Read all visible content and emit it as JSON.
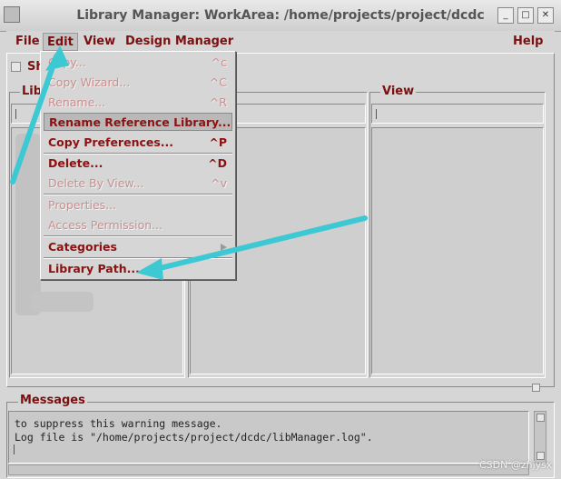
{
  "window": {
    "title": "Library Manager: WorkArea: /home/projects/project/dcdc"
  },
  "menubar": {
    "file": "File",
    "edit": "Edit",
    "view": "View",
    "design_manager": "Design Manager",
    "help": "Help"
  },
  "panes": {
    "show_checkbox_label": "Sh",
    "library_label": "Libr",
    "view_label": "View"
  },
  "edit_menu": {
    "items": [
      {
        "label": "Copy...",
        "shortcut": "^c",
        "enabled": false
      },
      {
        "label": "Copy Wizard...",
        "shortcut": "^C",
        "enabled": false
      },
      {
        "label": "Rename...",
        "shortcut": "^R",
        "enabled": false
      },
      {
        "label": "Rename Reference Library...",
        "shortcut": "",
        "enabled": true,
        "highlighted": true
      },
      {
        "label": "Copy Preferences...",
        "shortcut": "^P",
        "enabled": true
      },
      {
        "label": "Delete...",
        "shortcut": "^D",
        "enabled": true
      },
      {
        "label": "Delete By View...",
        "shortcut": "^v",
        "enabled": false
      },
      {
        "label": "Properties...",
        "shortcut": "",
        "enabled": false
      },
      {
        "label": "Access Permission...",
        "shortcut": "",
        "enabled": false
      },
      {
        "label": "Categories",
        "shortcut": "",
        "enabled": true,
        "submenu": true
      },
      {
        "label": "Library Path...",
        "shortcut": "",
        "enabled": true
      }
    ]
  },
  "messages": {
    "title": "Messages",
    "lines": [
      "to suppress this warning message.",
      "Log file is \"/home/projects/project/dcdc/libManager.log\"."
    ]
  },
  "watermark": "CSDN @zhjysx",
  "colors": {
    "menu_text": "#7a1010",
    "annotation_arrow": "#3cc9d4",
    "window_bg": "#d6d6d6"
  },
  "icons": {
    "close": "close-icon",
    "maximize": "maximize-icon",
    "minimize": "minimize-icon",
    "submenu": "chevron-right-icon"
  }
}
